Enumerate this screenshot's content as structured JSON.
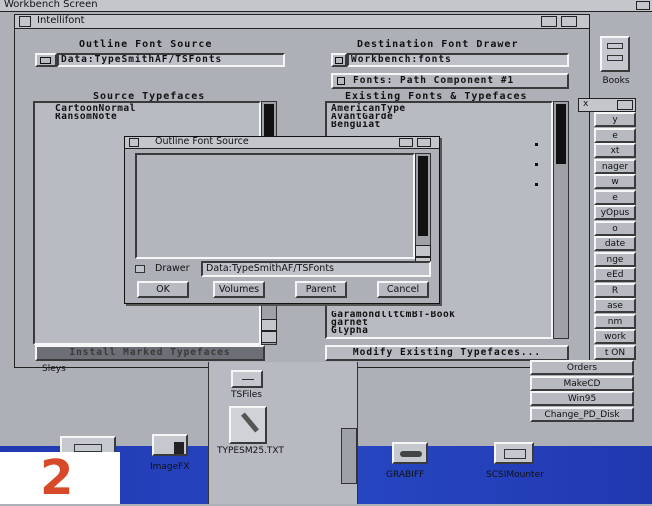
{
  "screen": {
    "title": "Workbench Screen"
  },
  "intellifont": {
    "title": "Intellifont",
    "outline_source_label": "Outline Font Source",
    "outline_source_path": "Data:TypeSmithAF/TSFonts",
    "destination_label": "Destination Font Drawer",
    "destination_path": "Workbench:fonts",
    "path_component": "Fonts: Path Component #1",
    "source_typefaces_label": "Source Typefaces",
    "source_typefaces": [
      "CartoonNormal",
      "RansomNote"
    ],
    "existing_label": "Existing Fonts & Typefaces",
    "existing_fonts_top": [
      "AmericanType",
      "AvantGarde",
      "Benguiat"
    ],
    "existing_fonts_bottom": [
      "GaramondlltCmBT-Book",
      "garnet",
      "Glypha"
    ],
    "install_button": "Install Marked Typefaces",
    "modify_button": "Modify Existing Typefaces..."
  },
  "file_requester": {
    "title": "Outline Font Source",
    "drawer_label": "Drawer",
    "drawer_value": "Data:TypeSmithAF/TSFonts",
    "ok": "OK",
    "volumes": "Volumes",
    "parent": "Parent",
    "cancel": "Cancel"
  },
  "right_panel": {
    "drawer_icon_label": "Books",
    "header": "x",
    "buttons": [
      "y",
      "e",
      "xt",
      "nager",
      "w",
      "e",
      "yOpus",
      "o",
      "date",
      "nge",
      "eEd",
      "R",
      "ase",
      "nm",
      "work",
      "t ON",
      "Orders",
      "MakeCD",
      "Win95",
      "Change_PD_Disk"
    ]
  },
  "desktop_icons": {
    "sleys": "Sleys",
    "tsfiles": "TSFiles",
    "typesm": "TYPESM25.TXT",
    "imagefx": "ImageFX",
    "grabiff": "GRABIFF",
    "scsimounter": "SCSIMounter"
  },
  "overlay": {
    "number": "2"
  },
  "colors": {
    "screen_bg": "#aeb0b8",
    "badge": "#d64a2a",
    "bottom_band": "#2440b8"
  }
}
